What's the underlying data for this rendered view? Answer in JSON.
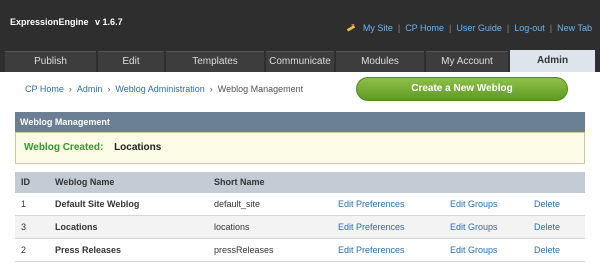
{
  "header": {
    "brand": "ExpressionEngine",
    "version": "v 1.6.7",
    "links": [
      "My Site",
      "CP Home",
      "User Guide",
      "Log-out",
      "New Tab"
    ]
  },
  "tabs": [
    {
      "label": "Publish"
    },
    {
      "label": "Edit"
    },
    {
      "label": "Templates"
    },
    {
      "label": "Communicate"
    },
    {
      "label": "Modules"
    },
    {
      "label": "My Account"
    },
    {
      "label": "Admin"
    }
  ],
  "breadcrumb": {
    "links": [
      "CP Home",
      "Admin",
      "Weblog Administration"
    ],
    "current": "Weblog Management"
  },
  "create_button": "Create a New Weblog",
  "panel": {
    "title": "Weblog Management",
    "notice_label": "Weblog Created:",
    "notice_value": "Locations"
  },
  "table": {
    "columns": [
      "ID",
      "Weblog Name",
      "Short Name"
    ],
    "rows": [
      {
        "id": "1",
        "name": "Default Site Weblog",
        "short": "default_site",
        "pref": "Edit Preferences",
        "groups": "Edit Groups",
        "delete": "Delete"
      },
      {
        "id": "3",
        "name": "Locations",
        "short": "locations",
        "pref": "Edit Preferences",
        "groups": "Edit Groups",
        "delete": "Delete"
      },
      {
        "id": "2",
        "name": "Press Releases",
        "short": "pressReleases",
        "pref": "Edit Preferences",
        "groups": "Edit Groups",
        "delete": "Delete"
      }
    ]
  },
  "colors": {
    "header_bg": "#2e2e2e",
    "link": "#2a6fb0",
    "top_link": "#6cb4f0",
    "button_green": "#6fa92e",
    "panel_head": "#6a7f93",
    "success": "#2f9a2f"
  }
}
